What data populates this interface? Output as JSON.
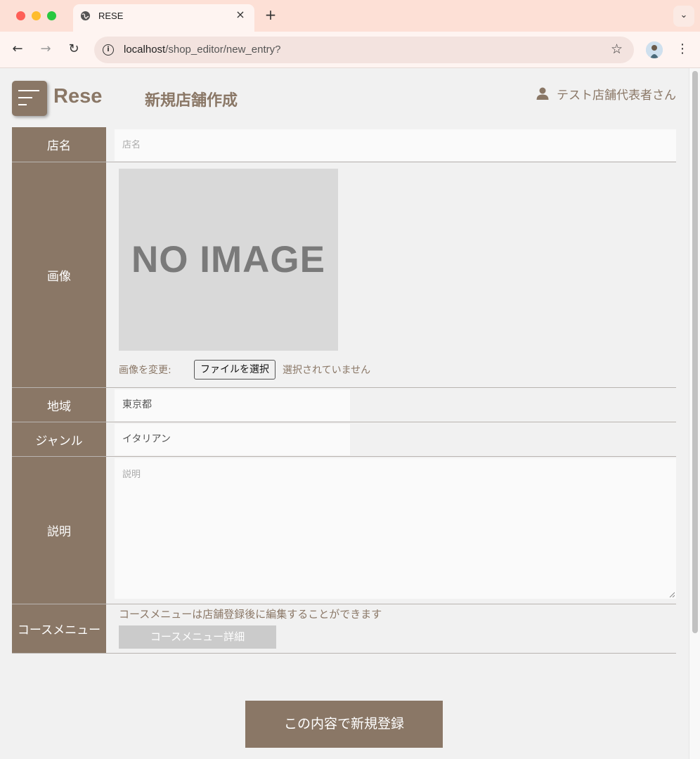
{
  "browser": {
    "tab_title": "RESE",
    "tab_close": "×",
    "new_tab": "+",
    "tab_menu": "⌄",
    "url_host": "localhost",
    "url_path": "/shop_editor/new_entry?",
    "icons": [
      "globe-icon",
      "back-icon",
      "forward-icon",
      "reload-icon",
      "info-icon",
      "star-icon",
      "profile-avatar",
      "kebab-menu-icon"
    ]
  },
  "header": {
    "logo": "Rese",
    "page_title": "新規店舗作成",
    "user_name": "テスト店舗代表者さん"
  },
  "form": {
    "name": {
      "label": "店名",
      "placeholder": "店名"
    },
    "image": {
      "label": "画像",
      "no_image_text": "NO IMAGE",
      "change_label": "画像を変更:",
      "file_button": "ファイルを選択",
      "file_status": "選択されていません"
    },
    "area": {
      "label": "地域",
      "value": "東京都"
    },
    "genre": {
      "label": "ジャンル",
      "value": "イタリアン"
    },
    "description": {
      "label": "説明",
      "placeholder": "説明"
    },
    "course": {
      "label": "コースメニュー",
      "note": "コースメニューは店舗登録後に編集することができます",
      "button": "コースメニュー詳細"
    }
  },
  "submit_label": "この内容で新規登録",
  "colors": {
    "brand": "#8a7766",
    "page_bg": "#f1f1f1",
    "field_bg": "#fafafa",
    "chrome_tab_bar": "#fde0d6"
  }
}
